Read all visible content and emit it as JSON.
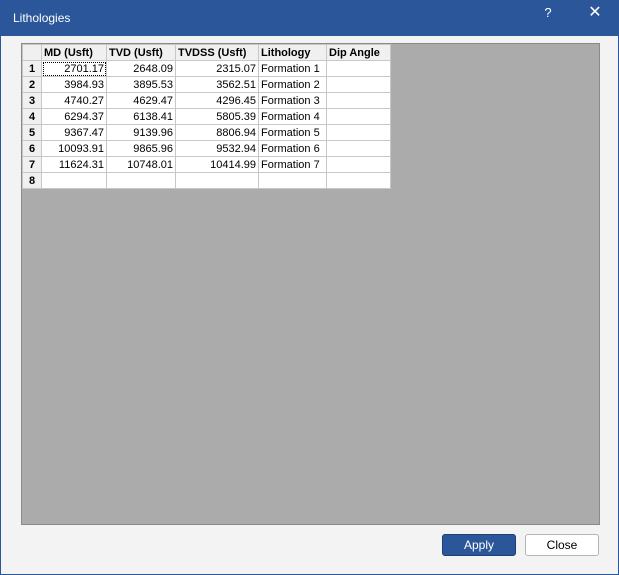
{
  "window": {
    "title": "Lithologies",
    "help_glyph": "?",
    "close_glyph": "✕"
  },
  "grid": {
    "columns": [
      "MD (Usft)",
      "TVD (Usft)",
      "TVDSS (Usft)",
      "Lithology",
      "Dip Angle"
    ],
    "rows": [
      {
        "num": "1",
        "md": "2701.17",
        "tvd": "2648.09",
        "tvdss": "2315.07",
        "lithology": "Formation 1",
        "dip": ""
      },
      {
        "num": "2",
        "md": "3984.93",
        "tvd": "3895.53",
        "tvdss": "3562.51",
        "lithology": "Formation 2",
        "dip": ""
      },
      {
        "num": "3",
        "md": "4740.27",
        "tvd": "4629.47",
        "tvdss": "4296.45",
        "lithology": "Formation 3",
        "dip": ""
      },
      {
        "num": "4",
        "md": "6294.37",
        "tvd": "6138.41",
        "tvdss": "5805.39",
        "lithology": "Formation 4",
        "dip": ""
      },
      {
        "num": "5",
        "md": "9367.47",
        "tvd": "9139.96",
        "tvdss": "8806.94",
        "lithology": "Formation 5",
        "dip": ""
      },
      {
        "num": "6",
        "md": "10093.91",
        "tvd": "9865.96",
        "tvdss": "9532.94",
        "lithology": "Formation 6",
        "dip": ""
      },
      {
        "num": "7",
        "md": "11624.31",
        "tvd": "10748.01",
        "tvdss": "10414.99",
        "lithology": "Formation 7",
        "dip": ""
      },
      {
        "num": "8",
        "md": "",
        "tvd": "",
        "tvdss": "",
        "lithology": "",
        "dip": ""
      }
    ]
  },
  "buttons": {
    "apply": "Apply",
    "close": "Close"
  }
}
